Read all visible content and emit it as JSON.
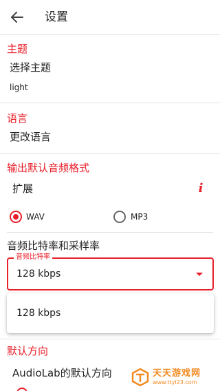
{
  "header": {
    "title": "设置",
    "back_icon": "arrow-left-icon"
  },
  "theme": {
    "section_title": "主题",
    "choose_label": "选择主题",
    "current_value": "light"
  },
  "language": {
    "section_title": "语言",
    "change_label": "更改语言"
  },
  "output_format": {
    "section_title": "输出默认音频格式",
    "extension_label": "扩展",
    "info_icon": "i",
    "options": [
      {
        "label": "WAV",
        "selected": true
      },
      {
        "label": "MP3",
        "selected": false
      }
    ]
  },
  "bitrate": {
    "section_title": "音频比特率和采样率",
    "field_label": "音频比特率",
    "selected_value": "128 kbps",
    "dropdown_options": [
      "128 kbps"
    ]
  },
  "direction": {
    "section_title": "默认方向",
    "description": "AudioLab的默认方向"
  },
  "watermark": {
    "name": "天天游戏网",
    "url": "www.ttyl23.com"
  },
  "colors": {
    "accent": "#e8202a",
    "divider": "#e2e2e2",
    "watermark": "#f28a21"
  }
}
